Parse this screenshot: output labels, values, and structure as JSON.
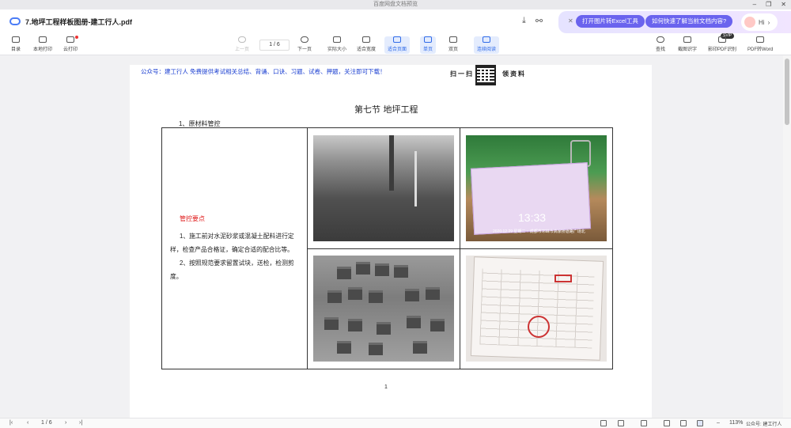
{
  "app": {
    "window_title": "百度网盘文档预览"
  },
  "tab": {
    "file_name": "7.地坪工程样板图册-建工行人.pdf"
  },
  "assistant": {
    "btn_excel": "打开图片转Excel工具",
    "btn_ask": "如何快速了解当前文档内容?",
    "greeting": "Hi"
  },
  "toolbar": {
    "left": [
      "目录",
      "本地打印",
      "云打印"
    ],
    "prev": "上一页",
    "page_value": "1 / 6",
    "next": "下一页",
    "actual_size": "实际大小",
    "fit_width": "适合宽度",
    "fit_page": "适合页面",
    "single": "单页",
    "double": "双页",
    "continuous": "连续阅读",
    "right": [
      "查找",
      "截图识字",
      "影印PDF识别",
      "PDF转Word"
    ],
    "vip_badge": "SVIP"
  },
  "document": {
    "notice": "公众号：建工行人 免费提供考试相关总结、背诵、口诀、习题、试卷、押题，关注即可下载！",
    "scan_text_a": "扫一扫",
    "scan_text_b": "领资料",
    "section_title": "第七节 地坪工程",
    "subsection": "1、原材料管控",
    "control_title": "管控要点",
    "points": [
      "1、施工前对水泥砂浆或混凝土配料进行定样，检查产品合格证，确定合适的配合比等。",
      "2、按照规范要求留置试块，送检，检测剪度。"
    ],
    "photo_time": "13:33",
    "photo_date": "2020.12.29 星期二 ↑ 成都市邛崃市高家桥道路广场北",
    "page_number": "1"
  },
  "statusbar": {
    "page_value": "1 / 6",
    "zoom": "113%",
    "watermark": "公众号: 建工行人"
  }
}
